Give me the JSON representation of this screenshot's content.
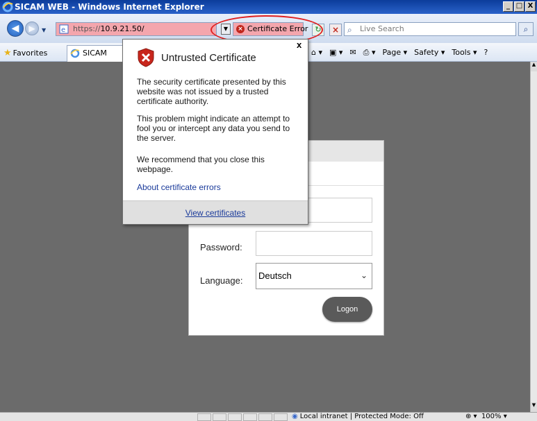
{
  "window": {
    "title": "SICAM WEB - Windows Internet Explorer",
    "controls": [
      "_",
      "□",
      "X"
    ]
  },
  "address_bar": {
    "url_prefix": "https://",
    "url_host": "10.9.21.50/",
    "cert_error_label": "Certificate Error",
    "search_placeholder": "Live Search"
  },
  "favorites_bar": {
    "favorites_label": "Favorites",
    "tab_label": "SICAM WEB",
    "commands": [
      "Page ▾",
      "Safety ▾",
      "Tools ▾"
    ]
  },
  "cert_popup": {
    "title": "Untrusted Certificate",
    "paragraph1": "The security certificate presented by this website was not issued by a trusted certificate authority.",
    "paragraph2": "This problem might indicate an attempt to fool you or intercept any data you send to the server.",
    "paragraph3": "We recommend that you close this webpage.",
    "about_link": "About certificate errors",
    "view_link": "View certificates",
    "close_glyph": "x"
  },
  "login": {
    "password_label": "Password:",
    "language_label": "Language:",
    "language_selected": "Deutsch",
    "logon_button": "Logon"
  },
  "status_bar": {
    "zone_text": "Local intranet | Protected Mode: Off",
    "zoom": "100%"
  },
  "colors": {
    "address_error_bg": "#f4a6ad",
    "titlebar": "#0b3c9b",
    "page_bg": "#6b6b6b",
    "highlight_ellipse": "#e02020"
  }
}
